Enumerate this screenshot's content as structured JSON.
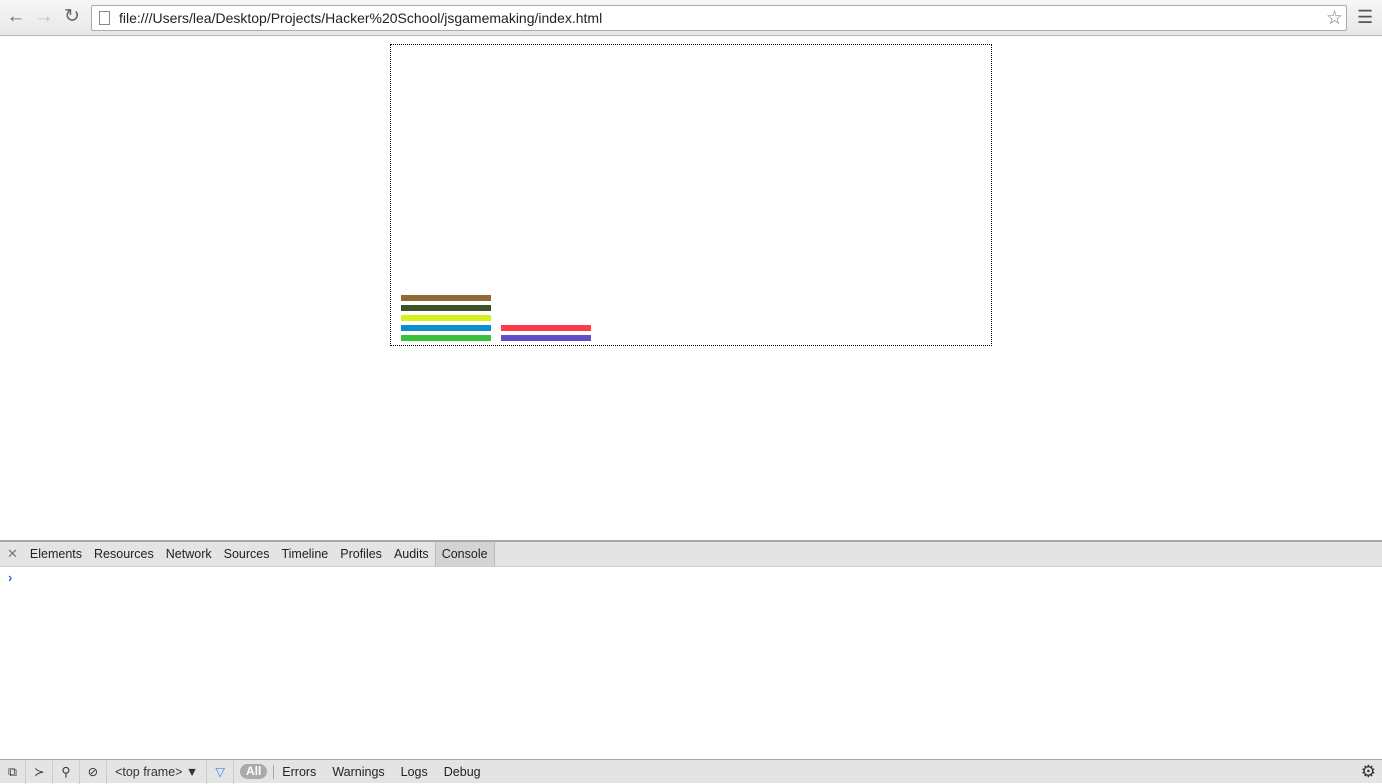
{
  "browser": {
    "url": "file:///Users/lea/Desktop/Projects/Hacker%20School/jsgamemaking/index.html",
    "icons": [
      "back-icon",
      "forward-icon",
      "reload-icon",
      "page-icon",
      "star-icon",
      "menu-icon"
    ]
  },
  "canvas": {
    "bars": [
      {
        "column": 1,
        "color": "#8f6a34"
      },
      {
        "column": 1,
        "color": "#3b5229"
      },
      {
        "column": 1,
        "color": "#d4f21f"
      },
      {
        "column": 1,
        "color": "#0c8ecb"
      },
      {
        "column": 1,
        "color": "#37c23a"
      },
      {
        "column": 2,
        "color": "#ff3a48"
      },
      {
        "column": 2,
        "color": "#634fc3"
      }
    ]
  },
  "devtools": {
    "tabs": [
      "Elements",
      "Resources",
      "Network",
      "Sources",
      "Timeline",
      "Profiles",
      "Audits",
      "Console"
    ],
    "active_tab": "Console",
    "prompt": "›",
    "frame_select": "<top frame> ▼",
    "filter_all": "All",
    "levels": [
      "Errors",
      "Warnings",
      "Logs",
      "Debug"
    ]
  }
}
